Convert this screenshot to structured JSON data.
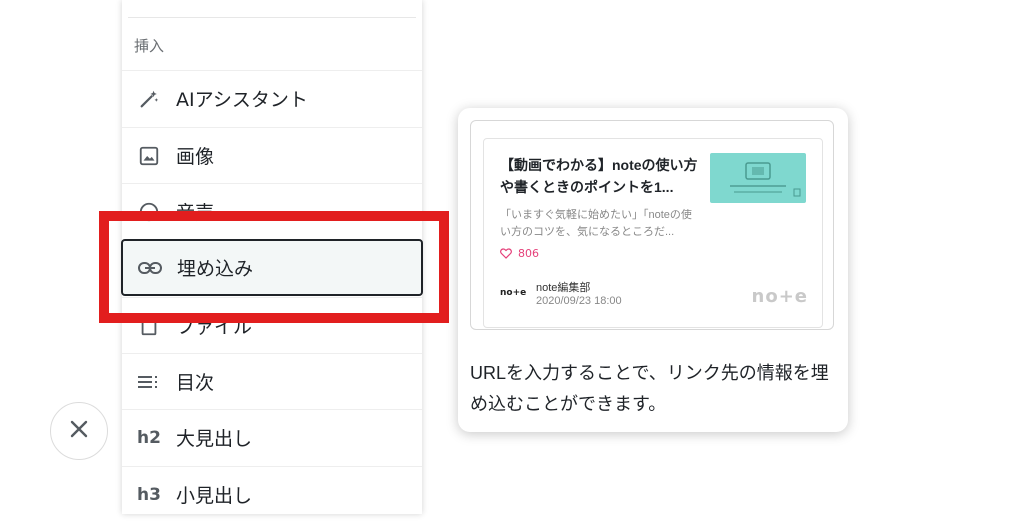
{
  "menu": {
    "header": "挿入",
    "items": [
      {
        "label": "AIアシスタント",
        "icon": "magic-wand-icon"
      },
      {
        "label": "画像",
        "icon": "image-icon"
      },
      {
        "label": "音声",
        "icon": "audio-icon"
      },
      {
        "label": "埋め込み",
        "icon": "link-icon"
      },
      {
        "label": "ファイル",
        "icon": "file-icon"
      },
      {
        "label": "目次",
        "icon": "toc-icon",
        "glyph": "≡⁝"
      },
      {
        "label": "大見出し",
        "icon": "heading-2-icon",
        "glyph": "h2"
      },
      {
        "label": "小見出し",
        "icon": "heading-3-icon",
        "glyph": "h3"
      }
    ]
  },
  "annotation": {
    "color": "#e21e1e"
  },
  "close_button": {
    "icon": "close-icon"
  },
  "tooltip": {
    "embed_preview": {
      "title": "【動画でわかる】noteの使い方や書くときのポイントを1...",
      "description": "「いますぐ気軽に始めたい」「noteの使い方のコツを、気になるところだ...",
      "likes": "806",
      "author_logo": "no+e",
      "author_name": "note編集部",
      "date": "2020/09/23 18:00",
      "brand": "no+e"
    },
    "description": "URLを入力することで、リンク先の情報を埋め込むことができます。"
  },
  "colors": {
    "like": "#e5417a",
    "thumbnail": "#7fd8cf"
  }
}
